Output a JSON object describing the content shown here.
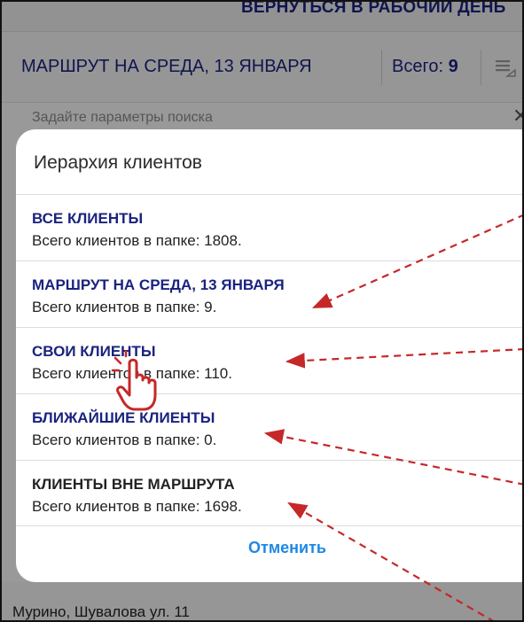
{
  "top_bar": {
    "label": "ВЕРНУТЬСЯ В РАБОЧИЙ ДЕНЬ"
  },
  "header": {
    "route_title": "МАРШРУТ НА СРЕДА, 13 ЯНВАРЯ",
    "total_label": "Всего:",
    "total_value": "9",
    "menu_icon": "list-filter-icon"
  },
  "search": {
    "placeholder": "Задайте параметры поиска",
    "clear_icon": "close-icon"
  },
  "background_address": "Мурино, Шувалова ул. 11",
  "dialog": {
    "title": "Иерархия клиентов",
    "items": [
      {
        "name": "ВСЕ КЛИЕНТЫ",
        "count": "Всего клиентов в папке: 1808."
      },
      {
        "name": "МАРШРУТ НА СРЕДА, 13 ЯНВАРЯ",
        "count": "Всего клиентов в папке: 9."
      },
      {
        "name": "СВОИ КЛИЕНТЫ",
        "count": "Всего клиентов в папке: 110."
      },
      {
        "name": "БЛИЖАЙШИЕ КЛИЕНТЫ",
        "count": "Всего клиентов в папке: 0."
      },
      {
        "name": "КЛИЕНТЫ ВНЕ МАРШРУТА",
        "count": "Всего клиентов в папке: 1698."
      }
    ],
    "cancel_label": "Отменить"
  },
  "annotations": {
    "arrow_color": "#c62828",
    "pointer_icon": "hand-pointer-icon"
  },
  "colors": {
    "item_title": "#1a237e",
    "cancel": "#1e88e5"
  }
}
